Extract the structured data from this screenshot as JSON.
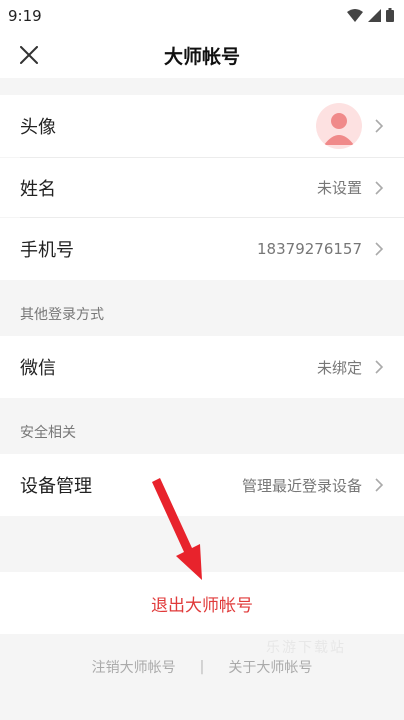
{
  "status_bar": {
    "time": "9:19"
  },
  "header": {
    "title": "大师帐号"
  },
  "profile": {
    "avatar_label": "头像",
    "name_label": "姓名",
    "name_value": "未设置",
    "phone_label": "手机号",
    "phone_value": "18379276157"
  },
  "other_login": {
    "section_title": "其他登录方式",
    "wechat_label": "微信",
    "wechat_value": "未绑定"
  },
  "security": {
    "section_title": "安全相关",
    "device_label": "设备管理",
    "device_value": "管理最近登录设备"
  },
  "logout_label": "退出大师帐号",
  "footer": {
    "cancel_account": "注销大师帐号",
    "separator": "|",
    "about": "关于大师帐号"
  },
  "watermark": "乐游下载站",
  "colors": {
    "accent_red": "#e03a3a",
    "avatar_bg": "#fde1e1",
    "avatar_fg": "#f08a8a"
  }
}
